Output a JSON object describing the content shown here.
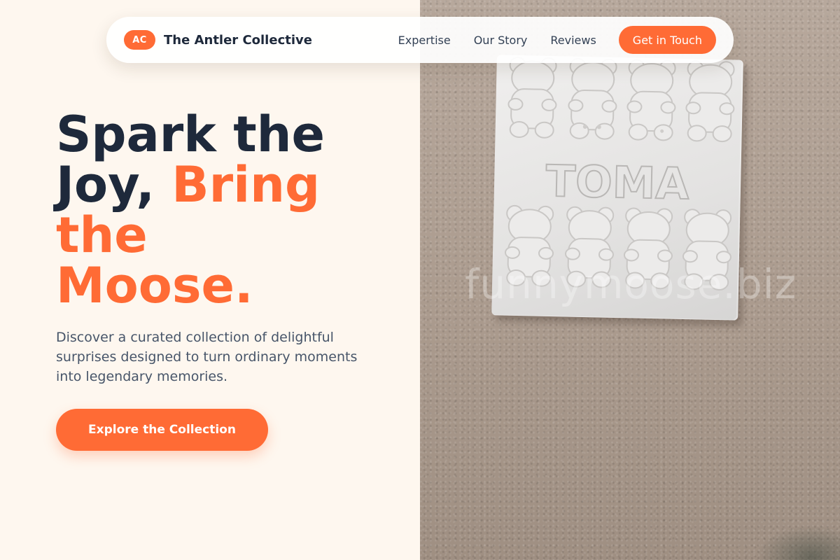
{
  "brand": {
    "badge": "AC",
    "name": "The Antler Collective",
    "accent_color": "#ff6b35"
  },
  "nav": {
    "links": [
      "Expertise",
      "Our Story",
      "Reviews"
    ],
    "cta_label": "Get in Touch"
  },
  "hero": {
    "title_line_1": "Spark the",
    "title_line_2a": "Joy, ",
    "title_line_2b": "Bring",
    "title_line_3": "the",
    "title_line_4": "Moose.",
    "subtitle": "Discover a curated collection of delightful surprises designed to turn ordinary moments into legendary memories.",
    "cta_label": "Explore the Collection"
  },
  "photo": {
    "plaque_text": "TOMA",
    "watermark": "funnymoose.biz"
  },
  "colors": {
    "text_dark": "#1e293b",
    "text_muted": "#475569",
    "background": "#fef7ef"
  }
}
